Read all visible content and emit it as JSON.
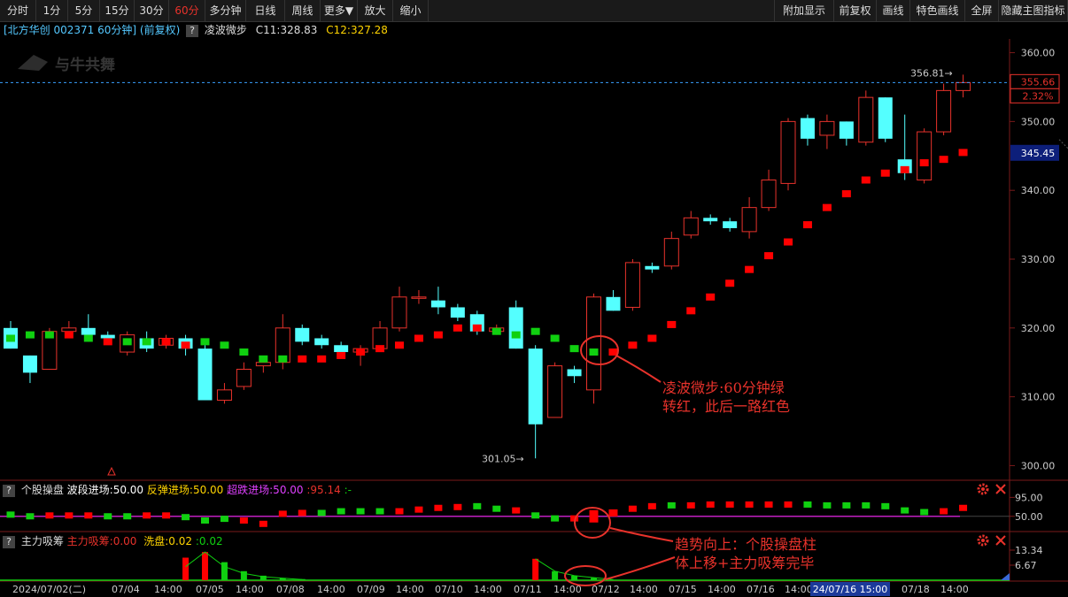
{
  "toolbar": {
    "left": [
      "分时",
      "1分",
      "5分",
      "15分",
      "30分",
      "60分",
      "多分钟",
      "日线",
      "周线",
      "更多▼",
      "放大",
      "缩小"
    ],
    "active_index": 5,
    "right": [
      "附加显示",
      "前复权",
      "画线",
      "特色画线",
      "全屏",
      "隐藏主图指标"
    ]
  },
  "header": {
    "title": "[北方华创 002371 60分钟] (前复权)",
    "help": "?",
    "indicator": "凌波微步",
    "c11": "C11:328.83",
    "c12": "C12:327.28"
  },
  "watermark": "与牛共舞",
  "price_axis": {
    "ticks": [
      "360.00",
      "350.00",
      "340.00",
      "330.00",
      "320.00",
      "310.00",
      "300.00"
    ],
    "current_price": "355.66",
    "current_pct": "2.32%",
    "c11_value": "345.45",
    "high_label": "356.81",
    "low_label": "301.05"
  },
  "panel2": {
    "name": "个股操盘",
    "l1": "波段进场:50.00",
    "l2": "反弹进场:50.00",
    "l3": "超跌进场:50.00",
    "l4": ":95.14",
    "l5": ":-",
    "ticks": [
      "95.00",
      "50.00"
    ]
  },
  "panel3": {
    "name": "主力吸筹",
    "l1": "主力吸筹:0.00",
    "l2": "洗盘:0.02",
    "l3": ":0.02",
    "ticks": [
      "13.34",
      "6.67"
    ]
  },
  "xaxis": {
    "labels": [
      "2024/07/02(二)",
      "07/04",
      "14:00",
      "07/05",
      "14:00",
      "07/08",
      "14:00",
      "07/09",
      "14:00",
      "07/10",
      "14:00",
      "07/11",
      "14:00",
      "07/12",
      "14:00",
      "07/15",
      "14:00",
      "07/16",
      "14:00",
      "07/18",
      "14:00"
    ],
    "cursor_label": "24/07/16 15:00"
  },
  "annotations": {
    "a1_line1": "凌波微步:60分钟绿",
    "a1_line2": "转红，此后一路红色",
    "a2_line1": "趋势向上：个股操盘柱",
    "a2_line2": "体上移+主力吸筹完毕"
  },
  "colors": {
    "up": "#e8322b",
    "down": "#54ffff",
    "green": "#10d010",
    "red_marker": "#ff0000",
    "magenta": "#c020c0"
  },
  "chart_data": {
    "type": "candlestick",
    "title": "北方华创 002371 60分钟 (前复权)",
    "y_range": [
      298,
      362
    ],
    "candles": [
      [
        320,
        317,
        321,
        317
      ],
      [
        316,
        313.5,
        316,
        312
      ],
      [
        314,
        319.5,
        320,
        314
      ],
      [
        319.5,
        320,
        321,
        319
      ],
      [
        320,
        319,
        322,
        318
      ],
      [
        319,
        318.5,
        319.5,
        318
      ],
      [
        316.5,
        319,
        319.5,
        316
      ],
      [
        318.5,
        317,
        319.5,
        316.5
      ],
      [
        317.5,
        318.5,
        319,
        317
      ],
      [
        318.5,
        317,
        319,
        316
      ],
      [
        317,
        309.5,
        317.5,
        309.5
      ],
      [
        309.5,
        311,
        312,
        309
      ],
      [
        311.5,
        314,
        315,
        311
      ],
      [
        314.5,
        315,
        315.5,
        313.5
      ],
      [
        315,
        320,
        322,
        314
      ],
      [
        320,
        318,
        320.5,
        317.5
      ],
      [
        318.5,
        317.5,
        319,
        317
      ],
      [
        317.5,
        316.5,
        318,
        316
      ],
      [
        316.5,
        317,
        317.5,
        314.5
      ],
      [
        317,
        320,
        321,
        316.5
      ],
      [
        320,
        324.5,
        326,
        319.5
      ],
      [
        324.5,
        324.5,
        325.5,
        323.5
      ],
      [
        324,
        323,
        326,
        322
      ],
      [
        323,
        321.5,
        323.5,
        321
      ],
      [
        322,
        319.5,
        322.5,
        319
      ],
      [
        319.5,
        320,
        320.5,
        319
      ],
      [
        323,
        317,
        324,
        317
      ],
      [
        317,
        306,
        317.5,
        301.05
      ],
      [
        307,
        314.5,
        315,
        307
      ],
      [
        314,
        313,
        314.5,
        312
      ],
      [
        311,
        324.5,
        325,
        309
      ],
      [
        324.5,
        322.5,
        325.5,
        322.5
      ],
      [
        323,
        329.5,
        330,
        322.5
      ],
      [
        329,
        328.5,
        329.5,
        328
      ],
      [
        329,
        333,
        334,
        328.5
      ],
      [
        333.5,
        336,
        337,
        333
      ],
      [
        336,
        335.5,
        336.5,
        335
      ],
      [
        335.5,
        334.5,
        336,
        334
      ],
      [
        334,
        337.5,
        339,
        333
      ],
      [
        337.5,
        341.5,
        343,
        337
      ],
      [
        341,
        350,
        350.5,
        340
      ],
      [
        350.5,
        347.5,
        351,
        346.5
      ],
      [
        348,
        350,
        351,
        346
      ],
      [
        350,
        347.5,
        350,
        346.5
      ],
      [
        347,
        353.5,
        354.5,
        346.5
      ],
      [
        353.5,
        347.5,
        353.5,
        347
      ],
      [
        344.5,
        342.5,
        351,
        341.5
      ],
      [
        341.5,
        348.5,
        349,
        341
      ],
      [
        348.5,
        354.5,
        355.5,
        348
      ],
      [
        354.5,
        355.66,
        356.81,
        353.5
      ]
    ],
    "indicator_steps": [
      {
        "v": 318.5,
        "c": "green"
      },
      {
        "v": 319,
        "c": "green"
      },
      {
        "v": 319,
        "c": "green"
      },
      {
        "v": 319,
        "c": "red"
      },
      {
        "v": 318.5,
        "c": "green"
      },
      {
        "v": 318,
        "c": "red"
      },
      {
        "v": 318,
        "c": "green"
      },
      {
        "v": 318,
        "c": "green"
      },
      {
        "v": 318,
        "c": "red"
      },
      {
        "v": 317.5,
        "c": "red"
      },
      {
        "v": 318,
        "c": "green"
      },
      {
        "v": 317.5,
        "c": "green"
      },
      {
        "v": 316.5,
        "c": "green"
      },
      {
        "v": 315.5,
        "c": "green"
      },
      {
        "v": 315.5,
        "c": "green"
      },
      {
        "v": 315.5,
        "c": "red"
      },
      {
        "v": 315.5,
        "c": "red"
      },
      {
        "v": 316,
        "c": "red"
      },
      {
        "v": 316.5,
        "c": "red"
      },
      {
        "v": 317,
        "c": "red"
      },
      {
        "v": 317.5,
        "c": "red"
      },
      {
        "v": 318.5,
        "c": "red"
      },
      {
        "v": 319,
        "c": "red"
      },
      {
        "v": 320,
        "c": "red"
      },
      {
        "v": 320,
        "c": "red"
      },
      {
        "v": 319.5,
        "c": "green"
      },
      {
        "v": 319,
        "c": "green"
      },
      {
        "v": 319.5,
        "c": "green"
      },
      {
        "v": 318.5,
        "c": "green"
      },
      {
        "v": 317,
        "c": "green"
      },
      {
        "v": 316.5,
        "c": "green"
      },
      {
        "v": 316.5,
        "c": "red"
      },
      {
        "v": 317.5,
        "c": "red"
      },
      {
        "v": 318.5,
        "c": "red"
      },
      {
        "v": 320.5,
        "c": "red"
      },
      {
        "v": 322.5,
        "c": "red"
      },
      {
        "v": 324.5,
        "c": "red"
      },
      {
        "v": 326.5,
        "c": "red"
      },
      {
        "v": 328.5,
        "c": "red"
      },
      {
        "v": 330.5,
        "c": "red"
      },
      {
        "v": 332.5,
        "c": "red"
      },
      {
        "v": 335,
        "c": "red"
      },
      {
        "v": 337.5,
        "c": "red"
      },
      {
        "v": 339.5,
        "c": "red"
      },
      {
        "v": 341.5,
        "c": "red"
      },
      {
        "v": 342.5,
        "c": "red"
      },
      {
        "v": 343,
        "c": "red"
      },
      {
        "v": 344,
        "c": "red"
      },
      {
        "v": 344.5,
        "c": "red"
      },
      {
        "v": 345.5,
        "c": "red"
      }
    ],
    "panel2_bars": [
      {
        "v": 54,
        "c": "green"
      },
      {
        "v": 50,
        "c": "green"
      },
      {
        "v": 52,
        "c": "red"
      },
      {
        "v": 52,
        "c": "red"
      },
      {
        "v": 52,
        "c": "red"
      },
      {
        "v": 50,
        "c": "green"
      },
      {
        "v": 50,
        "c": "green"
      },
      {
        "v": 52,
        "c": "red"
      },
      {
        "v": 52,
        "c": "red"
      },
      {
        "v": 48,
        "c": "green"
      },
      {
        "v": 40,
        "c": "green"
      },
      {
        "v": 44,
        "c": "green"
      },
      {
        "v": 40,
        "c": "red"
      },
      {
        "v": 32,
        "c": "red"
      },
      {
        "v": 56,
        "c": "red"
      },
      {
        "v": 58,
        "c": "red"
      },
      {
        "v": 58,
        "c": "green"
      },
      {
        "v": 62,
        "c": "green"
      },
      {
        "v": 62,
        "c": "green"
      },
      {
        "v": 62,
        "c": "green"
      },
      {
        "v": 62,
        "c": "red"
      },
      {
        "v": 66,
        "c": "red"
      },
      {
        "v": 70,
        "c": "red"
      },
      {
        "v": 72,
        "c": "red"
      },
      {
        "v": 74,
        "c": "green"
      },
      {
        "v": 68,
        "c": "green"
      },
      {
        "v": 64,
        "c": "red"
      },
      {
        "v": 52,
        "c": "green"
      },
      {
        "v": 45,
        "c": "green"
      },
      {
        "v": 45,
        "c": "red"
      },
      {
        "v": 50,
        "c": "green"
      },
      {
        "v": 58,
        "c": "red"
      },
      {
        "v": 68,
        "c": "red"
      },
      {
        "v": 74,
        "c": "red"
      },
      {
        "v": 76,
        "c": "green"
      },
      {
        "v": 76,
        "c": "red"
      },
      {
        "v": 78,
        "c": "red"
      },
      {
        "v": 78,
        "c": "red"
      },
      {
        "v": 78,
        "c": "red"
      },
      {
        "v": 78,
        "c": "red"
      },
      {
        "v": 78,
        "c": "red"
      },
      {
        "v": 78,
        "c": "green"
      },
      {
        "v": 76,
        "c": "green"
      },
      {
        "v": 76,
        "c": "green"
      },
      {
        "v": 76,
        "c": "green"
      },
      {
        "v": 74,
        "c": "green"
      },
      {
        "v": 64,
        "c": "green"
      },
      {
        "v": 60,
        "c": "green"
      },
      {
        "v": 62,
        "c": "red"
      },
      {
        "v": 70,
        "c": "red"
      }
    ],
    "panel3_bars": [
      {
        "i": 9,
        "v": 10,
        "c": "red"
      },
      {
        "i": 10,
        "v": 12.5,
        "c": "red"
      },
      {
        "i": 11,
        "v": 8,
        "c": "green"
      },
      {
        "i": 12,
        "v": 4,
        "c": "green"
      },
      {
        "i": 13,
        "v": 2,
        "c": "green"
      },
      {
        "i": 14,
        "v": 1,
        "c": "green"
      },
      {
        "i": 15,
        "v": 0.5,
        "c": "green"
      },
      {
        "i": 27,
        "v": 9.5,
        "c": "red"
      },
      {
        "i": 28,
        "v": 4,
        "c": "green"
      },
      {
        "i": 29,
        "v": 2,
        "c": "green"
      },
      {
        "i": 30,
        "v": 1,
        "c": "green"
      }
    ]
  }
}
